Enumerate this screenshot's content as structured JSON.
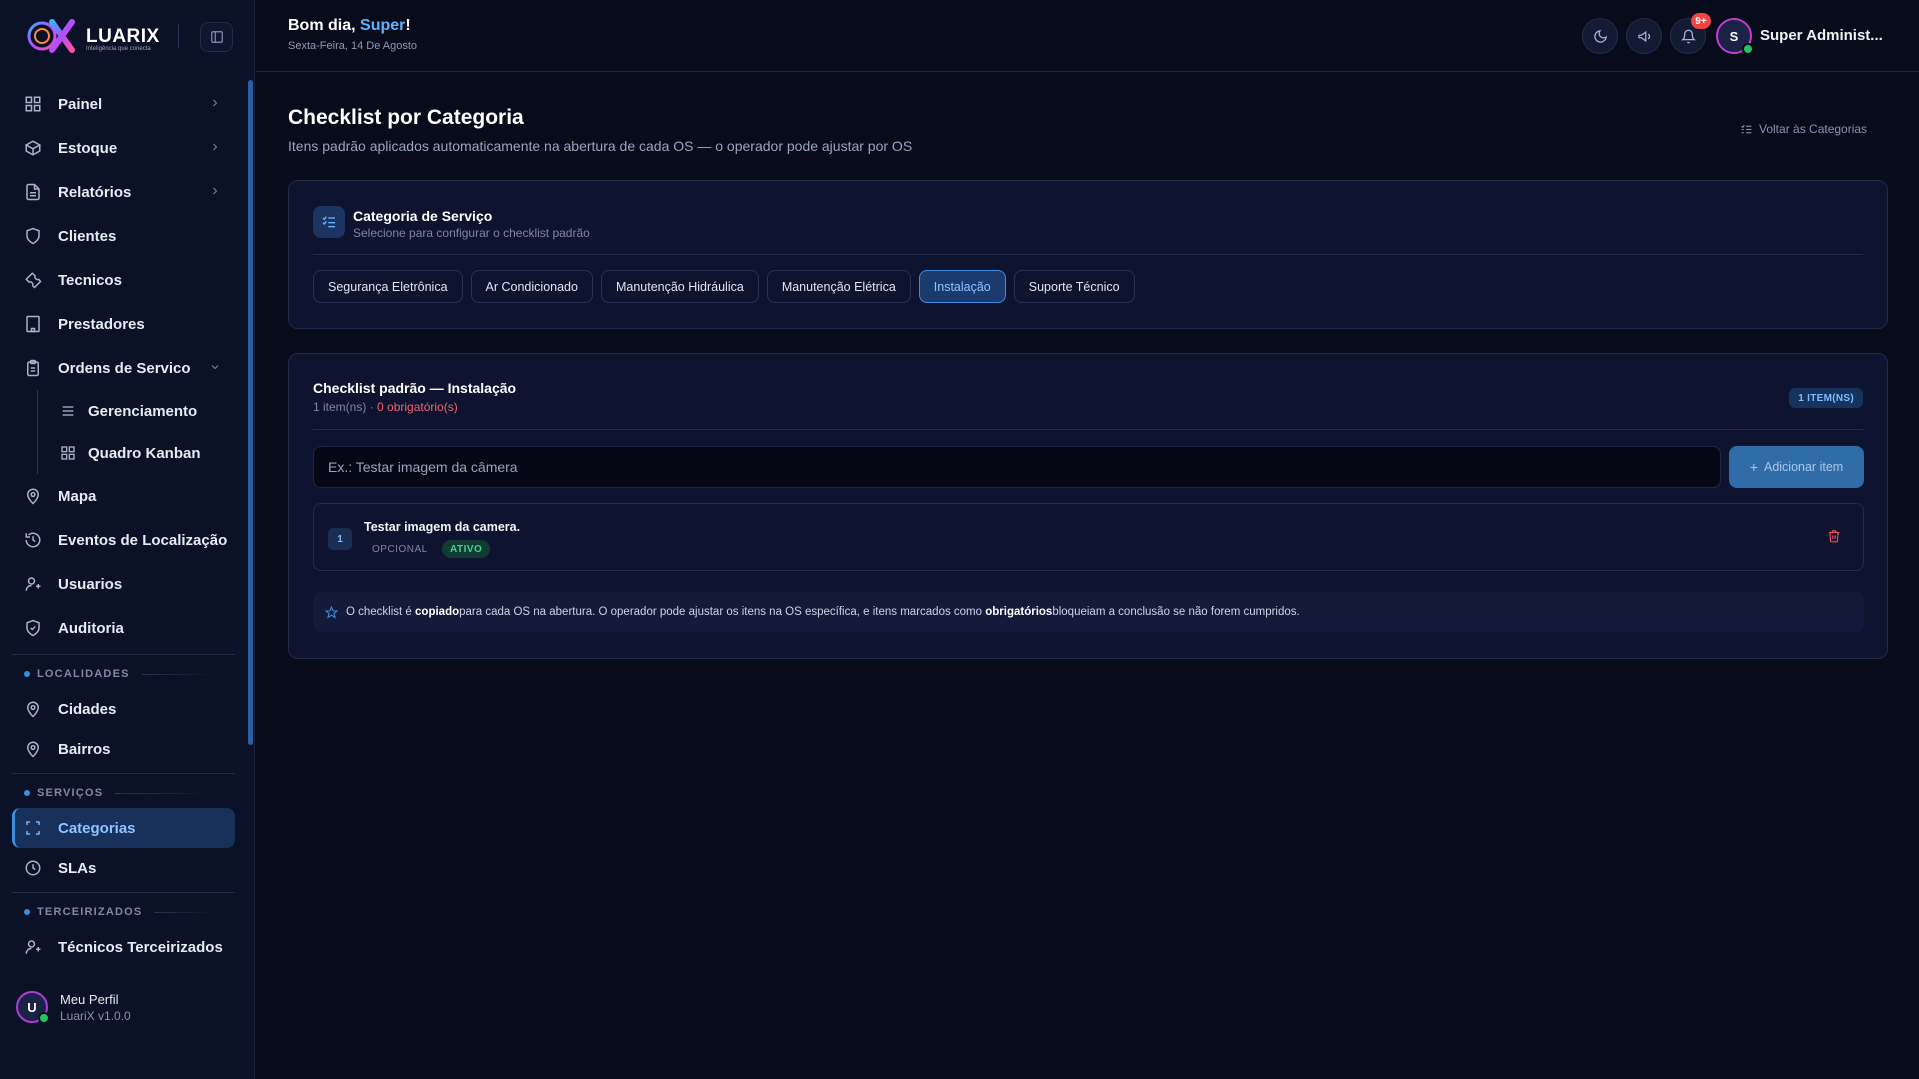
{
  "brand": {
    "name": "LUARIX",
    "tagline": "Inteligência que conecta"
  },
  "header": {
    "greeting_prefix": "Bom dia, ",
    "greeting_name": "Super",
    "greeting_suffix": "!",
    "date": "Sexta-Feira, 14 De Agosto",
    "notifications_badge": "9+",
    "user_initial": "S",
    "user_name": "Super Administ..."
  },
  "sidebar": {
    "items": [
      {
        "label": "Painel",
        "icon": "grid-icon"
      },
      {
        "label": "Estoque",
        "icon": "box-icon"
      },
      {
        "label": "Relatórios",
        "icon": "file-icon"
      },
      {
        "label": "Clientes",
        "icon": "shield-icon"
      },
      {
        "label": "Tecnicos",
        "icon": "wrench-icon"
      },
      {
        "label": "Prestadores",
        "icon": "building-icon"
      },
      {
        "label": "Ordens de Servico",
        "icon": "clipboard-icon"
      }
    ],
    "sub_items": [
      {
        "label": "Gerenciamento",
        "icon": "list-icon"
      },
      {
        "label": "Quadro Kanban",
        "icon": "kanban-icon"
      }
    ],
    "items_after": [
      {
        "label": "Mapa",
        "icon": "map-pin-icon"
      },
      {
        "label": "Eventos de Localização",
        "icon": "history-icon"
      },
      {
        "label": "Usuarios",
        "icon": "users-icon"
      },
      {
        "label": "Auditoria",
        "icon": "shield-check-icon"
      }
    ],
    "sections": {
      "localidades": {
        "label": "LOCALIDADES",
        "items": [
          "Cidades",
          "Bairros"
        ]
      },
      "servicos": {
        "label": "SERVIÇOS",
        "items": [
          "Categorias",
          "SLAs"
        ]
      },
      "terceirizados": {
        "label": "TERCEIRIZADOS",
        "items": [
          "Técnicos Terceirizados"
        ]
      }
    },
    "profile": {
      "initial": "U",
      "name": "Meu Perfil",
      "version": "LuariX v1.0.0"
    }
  },
  "page": {
    "title": "Checklist por Categoria",
    "subtitle": "Itens padrão aplicados automaticamente na abertura de cada OS — o operador pode ajustar por OS",
    "back_link": "Voltar às Categorias"
  },
  "category_card": {
    "title": "Categoria de Serviço",
    "subtitle": "Selecione para configurar o checklist padrão",
    "categories": [
      "Segurança Eletrônica",
      "Ar Condicionado",
      "Manutenção Hidráulica",
      "Manutenção Elétrica",
      "Instalação",
      "Suporte Técnico"
    ],
    "selected": "Instalação"
  },
  "checklist_card": {
    "title": "Checklist padrão — Instalação",
    "count_text": "1 item(ns) · ",
    "required_text": "0 obrigatório(s)",
    "badge": "1 ITEM(NS)",
    "input_placeholder": "Ex.: Testar imagem da câmera",
    "add_button": "Adicionar item",
    "items": [
      {
        "number": "1",
        "text": "Testar imagem da camera.",
        "type": "OPCIONAL",
        "status": "ATIVO"
      }
    ],
    "note": {
      "part1": "O checklist é ",
      "bold1": "copiado",
      "part2": " para cada OS na abertura. O operador pode ajustar os itens na OS específica, e itens marcados como ",
      "bold2": "obrigatórios",
      "part3": " bloqueiam a conclusão se não forem cumpridos."
    }
  },
  "colors": {
    "accent": "#3b8de0",
    "danger": "#ef4444",
    "success": "#22c55e"
  }
}
